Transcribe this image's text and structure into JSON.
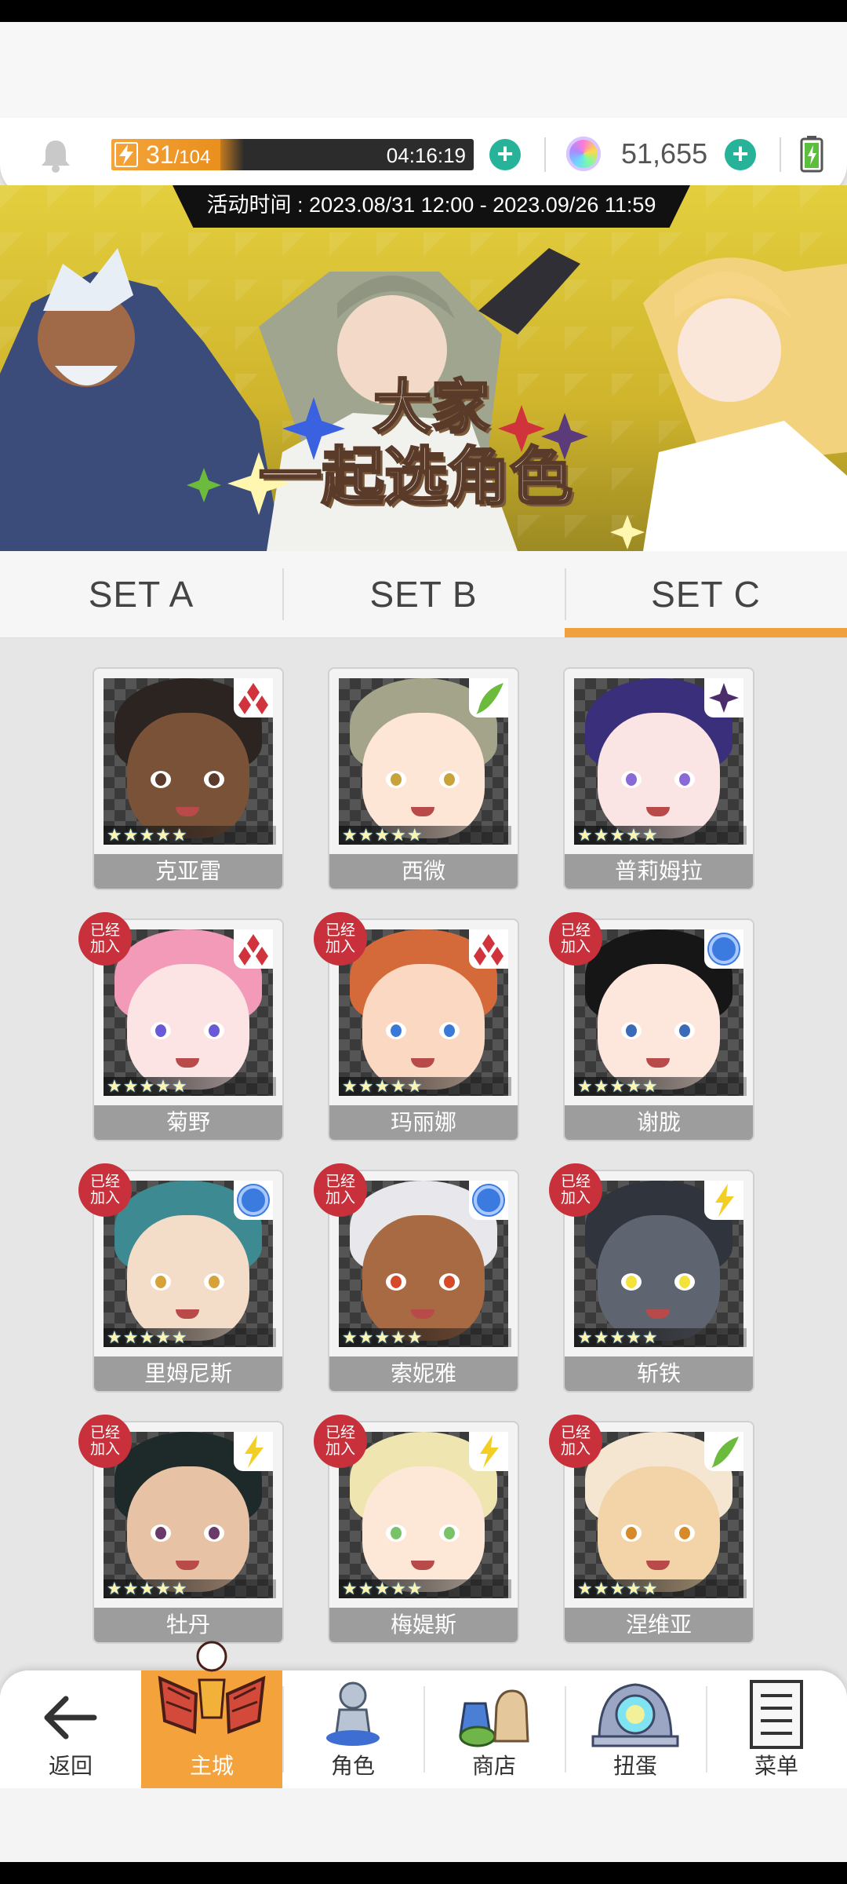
{
  "header": {
    "stamina_current": "31",
    "stamina_max": "104",
    "stamina_fraction": 0.3,
    "stamina_timer": "04:16:19",
    "gem_count": "51,655"
  },
  "banner": {
    "date_text": "活动时间 : 2023.08/31 12:00 - 2023.09/26 11:59",
    "title_line1": "大家",
    "title_line2": "一起选角色"
  },
  "tabs": [
    {
      "label": "SET A",
      "active": false
    },
    {
      "label": "SET B",
      "active": false
    },
    {
      "label": "SET C",
      "active": true
    }
  ],
  "characters": [
    {
      "name": "克亚雷",
      "joined": false,
      "element": "diamond-icon",
      "rarity": "★★★★★"
    },
    {
      "name": "西微",
      "joined": false,
      "element": "leaf-icon",
      "rarity": "★★★★★"
    },
    {
      "name": "普莉姆拉",
      "joined": false,
      "element": "dark-star-icon",
      "rarity": "★★★★★"
    },
    {
      "name": "菊野",
      "joined": true,
      "element": "diamond-icon",
      "rarity": "★★★★★"
    },
    {
      "name": "玛丽娜",
      "joined": true,
      "element": "diamond-icon",
      "rarity": "★★★★★"
    },
    {
      "name": "谢胧",
      "joined": true,
      "element": "water-circle-icon",
      "rarity": "★★★★★"
    },
    {
      "name": "里姆尼斯",
      "joined": true,
      "element": "water-circle-icon",
      "rarity": "★★★★★"
    },
    {
      "name": "索妮雅",
      "joined": true,
      "element": "water-circle-icon",
      "rarity": "★★★★★"
    },
    {
      "name": "斩铁",
      "joined": true,
      "element": "lightning-icon",
      "rarity": "★★★★★"
    },
    {
      "name": "牡丹",
      "joined": true,
      "element": "lightning-icon",
      "rarity": "★★★★★"
    },
    {
      "name": "梅媞斯",
      "joined": true,
      "element": "lightning-icon",
      "rarity": "★★★★★"
    },
    {
      "name": "涅维亚",
      "joined": true,
      "element": "leaf-icon",
      "rarity": "★★★★★"
    }
  ],
  "joined_label_1": "已经",
  "joined_label_2": "加入",
  "nav": [
    {
      "label": "返回",
      "icon": "back-arrow-icon",
      "active": false
    },
    {
      "label": "主城",
      "icon": "castle-icon",
      "active": true
    },
    {
      "label": "角色",
      "icon": "character-icon",
      "active": false
    },
    {
      "label": "商店",
      "icon": "shop-icon",
      "active": false
    },
    {
      "label": "扭蛋",
      "icon": "gacha-icon",
      "active": false
    },
    {
      "label": "菜单",
      "icon": "menu-icon",
      "active": false
    }
  ],
  "colors": {
    "accent": "#f4a23b",
    "plus_button": "#27b39a",
    "joined_badge": "#c8303b",
    "element_fire": "#d0333b",
    "element_wind": "#6dbb3c",
    "element_water": "#3b7be0",
    "element_thunder": "#f3cf26",
    "element_dark": "#4a2d6a"
  }
}
